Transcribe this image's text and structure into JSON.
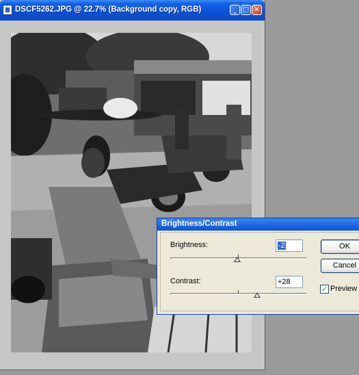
{
  "document_window": {
    "title": "DSCF5262.JPG @ 22.7% (Background copy, RGB)",
    "buttons": {
      "minimize": "_",
      "maximize": "□",
      "close": "✕"
    }
  },
  "dialog": {
    "title": "Brightness/Contrast",
    "brightness": {
      "label": "Brightness:",
      "value": "-2",
      "slider_value": -2,
      "range": [
        -100,
        100
      ]
    },
    "contrast": {
      "label": "Contrast:",
      "value": "+28",
      "slider_value": 28,
      "range": [
        -100,
        100
      ]
    },
    "ok_label": "OK",
    "cancel_label": "Cancel",
    "preview": {
      "label": "Preview",
      "checked": true
    }
  },
  "icons": {
    "app": "photoshop-document-icon",
    "minimize": "minimize-icon",
    "maximize": "maximize-icon",
    "close": "close-icon",
    "check": "checkmark-icon"
  },
  "colors": {
    "titlebar": "#0b52d6",
    "dialog_bg": "#ece9d8",
    "workspace": "#9a9a9a",
    "canvas_bg": "#c6c6c6"
  }
}
